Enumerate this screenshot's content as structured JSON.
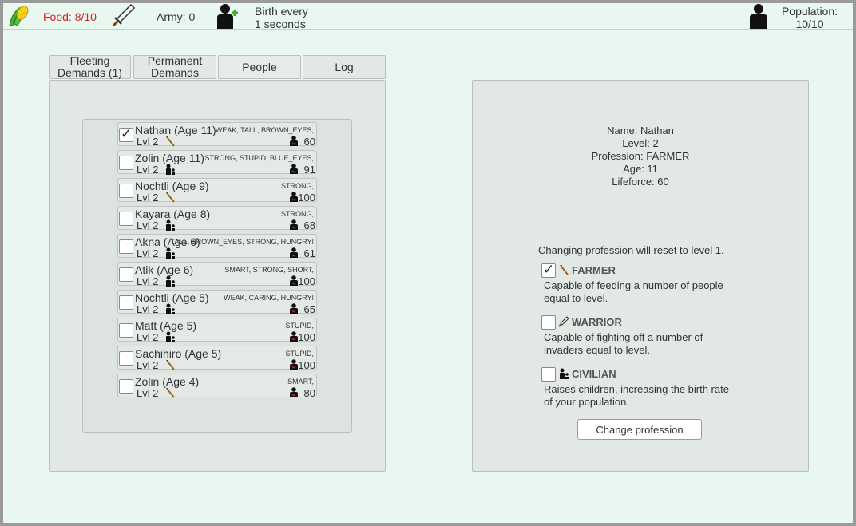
{
  "topbar": {
    "food": "Food: 8/10",
    "army": "Army: 0",
    "birth": "Birth every\n1 seconds",
    "population": "Population:\n10/10"
  },
  "tabs": [
    {
      "label": "Fleeting\nDemands (1)"
    },
    {
      "label": "Permanent\nDemands"
    },
    {
      "label": "People"
    },
    {
      "label": "Log"
    }
  ],
  "people": [
    {
      "name": "Nathan (Age 11)",
      "level": "Lvl 2",
      "profession": "farmer",
      "traits": "WEAK, TALL, BROWN_EYES,",
      "lifeforce": "60",
      "selected": true
    },
    {
      "name": "Zolin (Age 11)",
      "level": "Lvl 2",
      "profession": "civilian",
      "traits": "STRONG, STUPID, BLUE_EYES,",
      "lifeforce": "91",
      "selected": false
    },
    {
      "name": "Nochtli (Age 9)",
      "level": "Lvl 2",
      "profession": "farmer",
      "traits": "STRONG,",
      "lifeforce": "100",
      "selected": false
    },
    {
      "name": "Kayara (Age 8)",
      "level": "Lvl 2",
      "profession": "civilian",
      "traits": "STRONG,",
      "lifeforce": "68",
      "selected": false
    },
    {
      "name": "Akna (Age 6)",
      "level": "Lvl 2",
      "profession": "civilian",
      "traits": "TALL, BROWN_EYES, STRONG,   HUNGRY!",
      "lifeforce": "61",
      "selected": false
    },
    {
      "name": "Atik (Age 6)",
      "level": "Lvl 2",
      "profession": "civilian",
      "traits": "SMART, STRONG, SHORT,",
      "lifeforce": "100",
      "selected": false
    },
    {
      "name": "Nochtli (Age 5)",
      "level": "Lvl 2",
      "profession": "civilian",
      "traits": "WEAK, CARING,   HUNGRY!",
      "lifeforce": "65",
      "selected": false
    },
    {
      "name": "Matt (Age 5)",
      "level": "Lvl 2",
      "profession": "civilian",
      "traits": "STUPID,",
      "lifeforce": "100",
      "selected": false
    },
    {
      "name": "Sachihiro (Age 5)",
      "level": "Lvl 2",
      "profession": "farmer",
      "traits": "STUPID,",
      "lifeforce": "100",
      "selected": false
    },
    {
      "name": "Zolin (Age 4)",
      "level": "Lvl 2",
      "profession": "farmer",
      "traits": "SMART,",
      "lifeforce": "80",
      "selected": false
    }
  ],
  "details": {
    "name": "Name: Nathan",
    "level": "Level: 2",
    "profession": "Profession: FARMER",
    "age": "Age: 11",
    "lifeforce": "Lifeforce: 60"
  },
  "profession_warning": "Changing profession will reset to level 1.",
  "professions": [
    {
      "key": "farmer",
      "name": "FARMER",
      "desc": "Capable of feeding a number of people equal to level.",
      "checked": true
    },
    {
      "key": "warrior",
      "name": "WARRIOR",
      "desc": "Capable of fighting off a number of invaders equal to level.",
      "checked": false
    },
    {
      "key": "civilian",
      "name": "CIVILIAN",
      "desc": "Raises children, increasing the birth rate of your population.",
      "checked": false
    }
  ],
  "change_button": "Change profession",
  "colors": {
    "food": "#d71f1f",
    "background": "#e8f7ef",
    "panel": "#e2e9e5"
  }
}
